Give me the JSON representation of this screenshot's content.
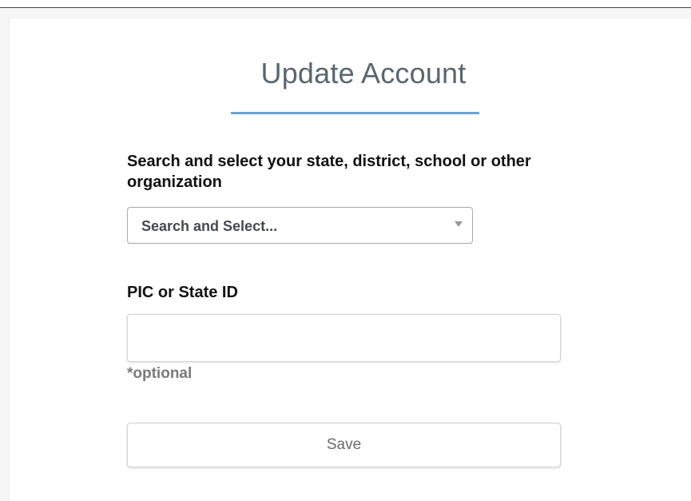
{
  "form": {
    "title": "Update Account",
    "organization": {
      "label": "Search and select your state, district, school or other organization",
      "select_value": "Search and Select..."
    },
    "pic": {
      "label": "PIC or State ID",
      "value": "",
      "note": "*optional"
    },
    "save_label": "Save"
  },
  "colors": {
    "accent_underline": "#6fa3cf",
    "title_text": "#5a6670"
  }
}
